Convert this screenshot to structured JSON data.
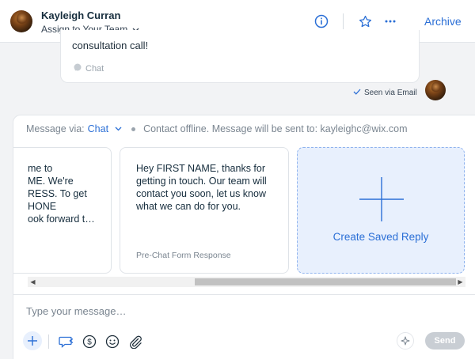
{
  "header": {
    "contact_name": "Kayleigh Curran",
    "assign_label": "Assign to Your Team",
    "archive_label": "Archive"
  },
  "message": {
    "text": "consultation call!",
    "source": "Chat",
    "seen_status": "Seen via Email"
  },
  "composer": {
    "via_label": "Message via:",
    "channel": "Chat",
    "contact_status": "Contact offline. Message will be sent to: kayleighc@wix.com",
    "saved_replies": [
      {
        "body": "me to\nME. We're\nRESS. To get\nHONE\nook forward t…",
        "footer": ""
      },
      {
        "body": "Hey FIRST NAME, thanks for\ngetting in touch. Our team will\ncontact you soon, let us know\nwhat we can do for you.",
        "footer": "Pre-Chat Form Response"
      }
    ],
    "create_saved_reply_label": "Create Saved Reply",
    "input_placeholder": "Type your message…",
    "send_label": "Send"
  },
  "colors": {
    "accent": "#2b6fd6",
    "create_card_bg": "#e8f0fd",
    "send_disabled": "#c9ced4"
  }
}
